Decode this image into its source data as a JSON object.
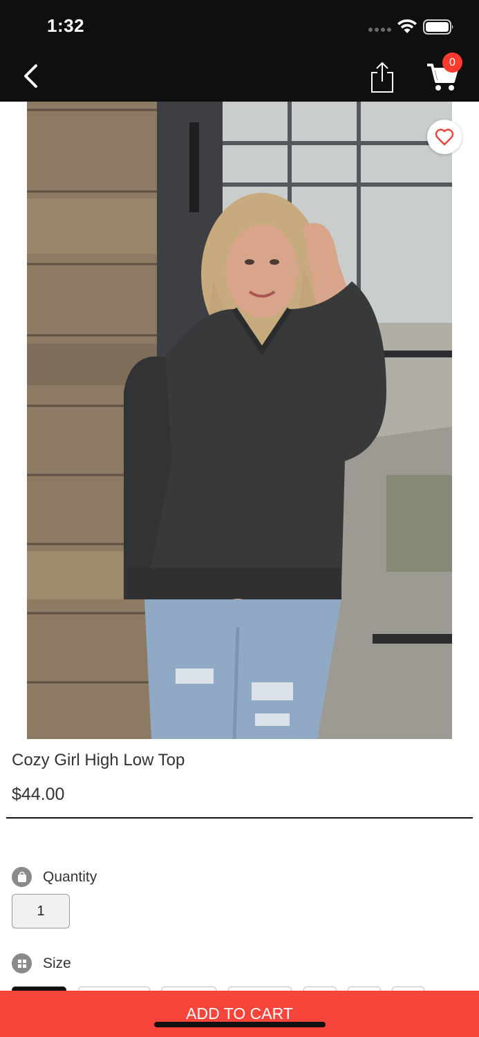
{
  "status_bar": {
    "time": "1:32",
    "icons": [
      "signal-dots-icon",
      "wifi-icon",
      "battery-icon"
    ]
  },
  "nav_bar": {
    "back_icon": "chevron-left-icon",
    "share_icon": "share-icon",
    "cart_icon": "shopping-cart-icon",
    "cart_count": "0"
  },
  "product": {
    "image_subject": "photo",
    "favorite_icon": "heart-icon",
    "title": "Cozy Girl High Low Top",
    "price": "$44.00"
  },
  "options": {
    "quantity_label": "Quantity",
    "quantity_value": "1",
    "quantity_icon": "bag-icon",
    "size_label": "Size",
    "size_icon": "grid-icon"
  },
  "cta": {
    "add_to_cart_label": "ADD TO CART"
  },
  "colors": {
    "accent": "#f8453c",
    "badge": "#ff3b30",
    "nav_background": "#0f0f0f"
  }
}
